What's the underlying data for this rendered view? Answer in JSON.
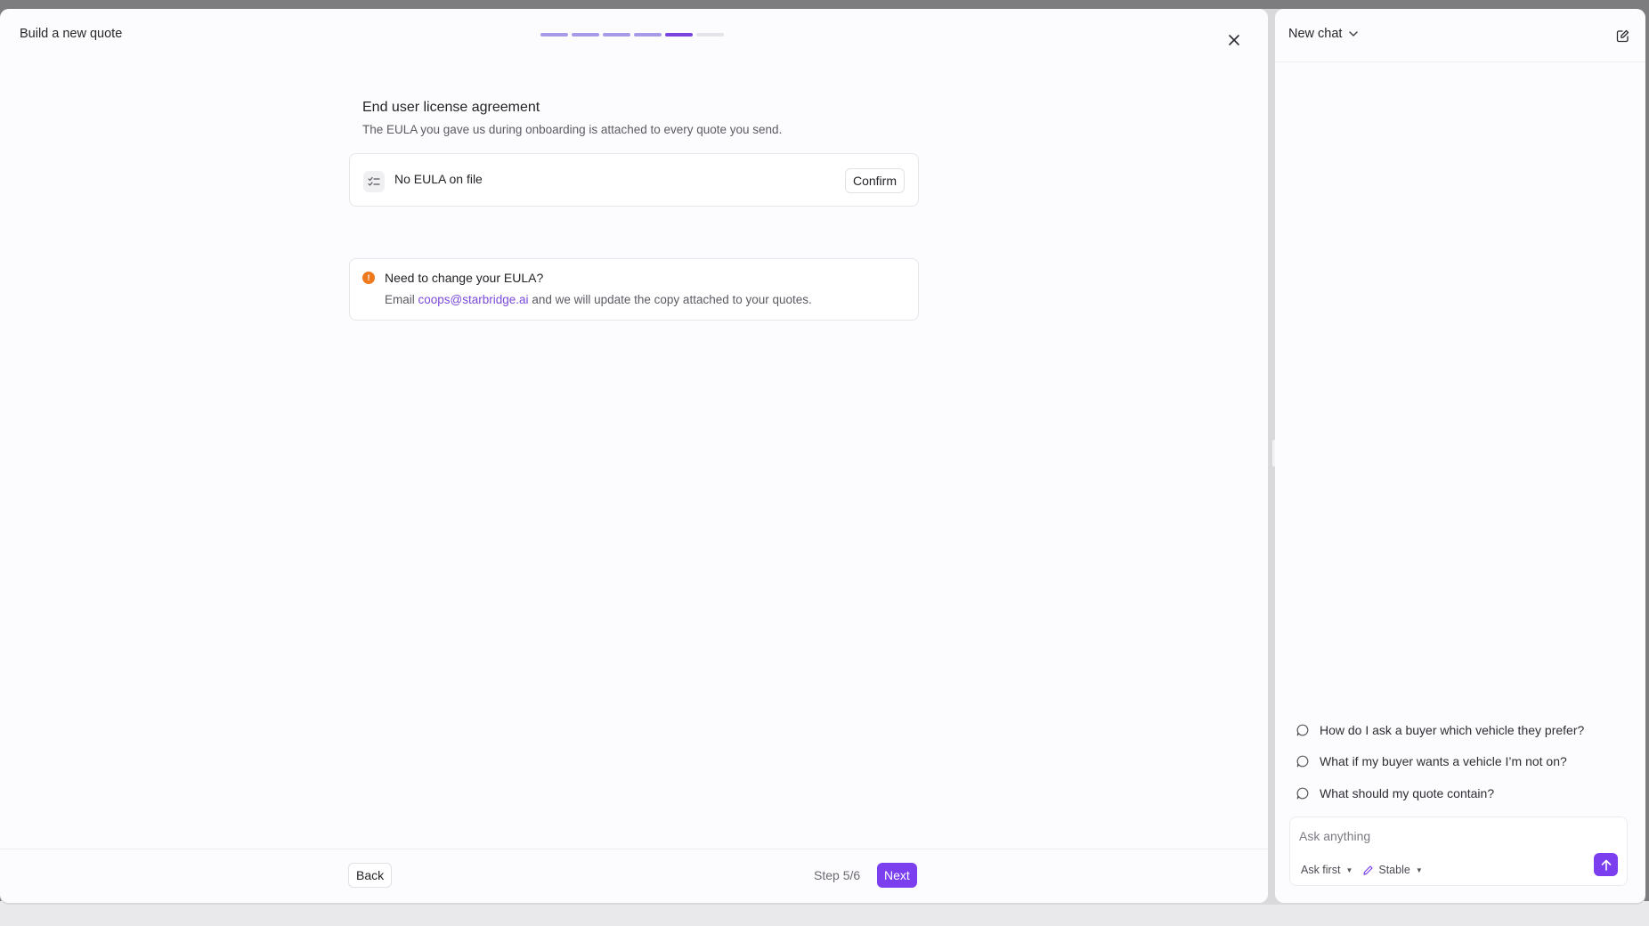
{
  "wizard": {
    "title": "Build a new quote",
    "progress": {
      "total_steps": 6,
      "current_step": 5
    },
    "section": {
      "title": "End user license agreement",
      "subtitle": "The EULA you gave us during onboarding is attached to every quote you send."
    },
    "eula_card": {
      "status": "No EULA on file",
      "confirm_label": "Confirm"
    },
    "note": {
      "title": "Need to change your EULA?",
      "body_prefix": "Email",
      "email": "coops@starbridge.ai",
      "body_suffix": "and we will update the copy attached to your quotes."
    },
    "footer": {
      "back_label": "Back",
      "step_label": "Step 5/6",
      "next_label": "Next"
    }
  },
  "chat": {
    "title": "New chat",
    "suggestions": [
      "How do I ask a buyer which vehicle they prefer?",
      "What if my buyer wants a vehicle I’m not on?",
      "What should my quote contain?"
    ],
    "composer": {
      "placeholder": "Ask anything",
      "mode_label": "Ask first",
      "model_label": "Stable"
    }
  },
  "colors": {
    "accent": "#7b3ff0",
    "progress_done": "#a99ae8",
    "progress_current": "#7b43e0",
    "warning": "#ef7a1e",
    "link": "#7a4ad9"
  }
}
